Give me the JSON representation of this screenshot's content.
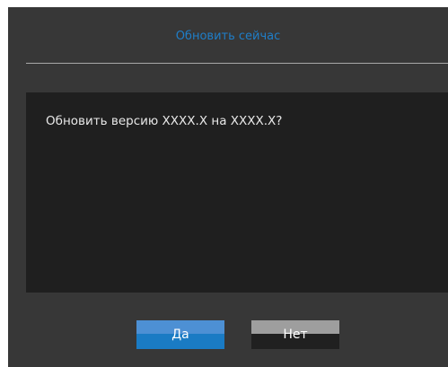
{
  "dialog": {
    "title": "Обновить сейчас",
    "message": "Обновить версию XXXX.X на XXXX.X?",
    "buttons": {
      "yes_label": "Да",
      "no_label": "Нет"
    }
  },
  "colors": {
    "background": "#373737",
    "message_background": "#1f1f1f",
    "title_text": "#1f7ec8",
    "yes_button_top": "#4d90d4",
    "yes_button_bottom": "#1a7bc4",
    "no_button_top": "#9e9e9e",
    "no_button_bottom": "#202020"
  }
}
